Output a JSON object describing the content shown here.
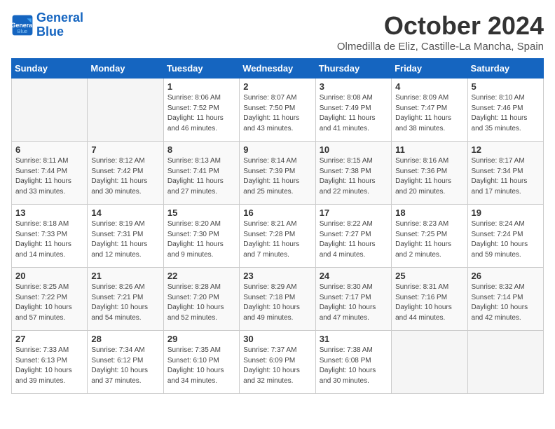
{
  "logo": {
    "line1": "General",
    "line2": "Blue"
  },
  "title": "October 2024",
  "location": "Olmedilla de Eliz, Castille-La Mancha, Spain",
  "days_of_week": [
    "Sunday",
    "Monday",
    "Tuesday",
    "Wednesday",
    "Thursday",
    "Friday",
    "Saturday"
  ],
  "weeks": [
    [
      {
        "day": "",
        "sunrise": "",
        "sunset": "",
        "daylight": ""
      },
      {
        "day": "",
        "sunrise": "",
        "sunset": "",
        "daylight": ""
      },
      {
        "day": "1",
        "sunrise": "Sunrise: 8:06 AM",
        "sunset": "Sunset: 7:52 PM",
        "daylight": "Daylight: 11 hours and 46 minutes."
      },
      {
        "day": "2",
        "sunrise": "Sunrise: 8:07 AM",
        "sunset": "Sunset: 7:50 PM",
        "daylight": "Daylight: 11 hours and 43 minutes."
      },
      {
        "day": "3",
        "sunrise": "Sunrise: 8:08 AM",
        "sunset": "Sunset: 7:49 PM",
        "daylight": "Daylight: 11 hours and 41 minutes."
      },
      {
        "day": "4",
        "sunrise": "Sunrise: 8:09 AM",
        "sunset": "Sunset: 7:47 PM",
        "daylight": "Daylight: 11 hours and 38 minutes."
      },
      {
        "day": "5",
        "sunrise": "Sunrise: 8:10 AM",
        "sunset": "Sunset: 7:46 PM",
        "daylight": "Daylight: 11 hours and 35 minutes."
      }
    ],
    [
      {
        "day": "6",
        "sunrise": "Sunrise: 8:11 AM",
        "sunset": "Sunset: 7:44 PM",
        "daylight": "Daylight: 11 hours and 33 minutes."
      },
      {
        "day": "7",
        "sunrise": "Sunrise: 8:12 AM",
        "sunset": "Sunset: 7:42 PM",
        "daylight": "Daylight: 11 hours and 30 minutes."
      },
      {
        "day": "8",
        "sunrise": "Sunrise: 8:13 AM",
        "sunset": "Sunset: 7:41 PM",
        "daylight": "Daylight: 11 hours and 27 minutes."
      },
      {
        "day": "9",
        "sunrise": "Sunrise: 8:14 AM",
        "sunset": "Sunset: 7:39 PM",
        "daylight": "Daylight: 11 hours and 25 minutes."
      },
      {
        "day": "10",
        "sunrise": "Sunrise: 8:15 AM",
        "sunset": "Sunset: 7:38 PM",
        "daylight": "Daylight: 11 hours and 22 minutes."
      },
      {
        "day": "11",
        "sunrise": "Sunrise: 8:16 AM",
        "sunset": "Sunset: 7:36 PM",
        "daylight": "Daylight: 11 hours and 20 minutes."
      },
      {
        "day": "12",
        "sunrise": "Sunrise: 8:17 AM",
        "sunset": "Sunset: 7:34 PM",
        "daylight": "Daylight: 11 hours and 17 minutes."
      }
    ],
    [
      {
        "day": "13",
        "sunrise": "Sunrise: 8:18 AM",
        "sunset": "Sunset: 7:33 PM",
        "daylight": "Daylight: 11 hours and 14 minutes."
      },
      {
        "day": "14",
        "sunrise": "Sunrise: 8:19 AM",
        "sunset": "Sunset: 7:31 PM",
        "daylight": "Daylight: 11 hours and 12 minutes."
      },
      {
        "day": "15",
        "sunrise": "Sunrise: 8:20 AM",
        "sunset": "Sunset: 7:30 PM",
        "daylight": "Daylight: 11 hours and 9 minutes."
      },
      {
        "day": "16",
        "sunrise": "Sunrise: 8:21 AM",
        "sunset": "Sunset: 7:28 PM",
        "daylight": "Daylight: 11 hours and 7 minutes."
      },
      {
        "day": "17",
        "sunrise": "Sunrise: 8:22 AM",
        "sunset": "Sunset: 7:27 PM",
        "daylight": "Daylight: 11 hours and 4 minutes."
      },
      {
        "day": "18",
        "sunrise": "Sunrise: 8:23 AM",
        "sunset": "Sunset: 7:25 PM",
        "daylight": "Daylight: 11 hours and 2 minutes."
      },
      {
        "day": "19",
        "sunrise": "Sunrise: 8:24 AM",
        "sunset": "Sunset: 7:24 PM",
        "daylight": "Daylight: 10 hours and 59 minutes."
      }
    ],
    [
      {
        "day": "20",
        "sunrise": "Sunrise: 8:25 AM",
        "sunset": "Sunset: 7:22 PM",
        "daylight": "Daylight: 10 hours and 57 minutes."
      },
      {
        "day": "21",
        "sunrise": "Sunrise: 8:26 AM",
        "sunset": "Sunset: 7:21 PM",
        "daylight": "Daylight: 10 hours and 54 minutes."
      },
      {
        "day": "22",
        "sunrise": "Sunrise: 8:28 AM",
        "sunset": "Sunset: 7:20 PM",
        "daylight": "Daylight: 10 hours and 52 minutes."
      },
      {
        "day": "23",
        "sunrise": "Sunrise: 8:29 AM",
        "sunset": "Sunset: 7:18 PM",
        "daylight": "Daylight: 10 hours and 49 minutes."
      },
      {
        "day": "24",
        "sunrise": "Sunrise: 8:30 AM",
        "sunset": "Sunset: 7:17 PM",
        "daylight": "Daylight: 10 hours and 47 minutes."
      },
      {
        "day": "25",
        "sunrise": "Sunrise: 8:31 AM",
        "sunset": "Sunset: 7:16 PM",
        "daylight": "Daylight: 10 hours and 44 minutes."
      },
      {
        "day": "26",
        "sunrise": "Sunrise: 8:32 AM",
        "sunset": "Sunset: 7:14 PM",
        "daylight": "Daylight: 10 hours and 42 minutes."
      }
    ],
    [
      {
        "day": "27",
        "sunrise": "Sunrise: 7:33 AM",
        "sunset": "Sunset: 6:13 PM",
        "daylight": "Daylight: 10 hours and 39 minutes."
      },
      {
        "day": "28",
        "sunrise": "Sunrise: 7:34 AM",
        "sunset": "Sunset: 6:12 PM",
        "daylight": "Daylight: 10 hours and 37 minutes."
      },
      {
        "day": "29",
        "sunrise": "Sunrise: 7:35 AM",
        "sunset": "Sunset: 6:10 PM",
        "daylight": "Daylight: 10 hours and 34 minutes."
      },
      {
        "day": "30",
        "sunrise": "Sunrise: 7:37 AM",
        "sunset": "Sunset: 6:09 PM",
        "daylight": "Daylight: 10 hours and 32 minutes."
      },
      {
        "day": "31",
        "sunrise": "Sunrise: 7:38 AM",
        "sunset": "Sunset: 6:08 PM",
        "daylight": "Daylight: 10 hours and 30 minutes."
      },
      {
        "day": "",
        "sunrise": "",
        "sunset": "",
        "daylight": ""
      },
      {
        "day": "",
        "sunrise": "",
        "sunset": "",
        "daylight": ""
      }
    ]
  ]
}
